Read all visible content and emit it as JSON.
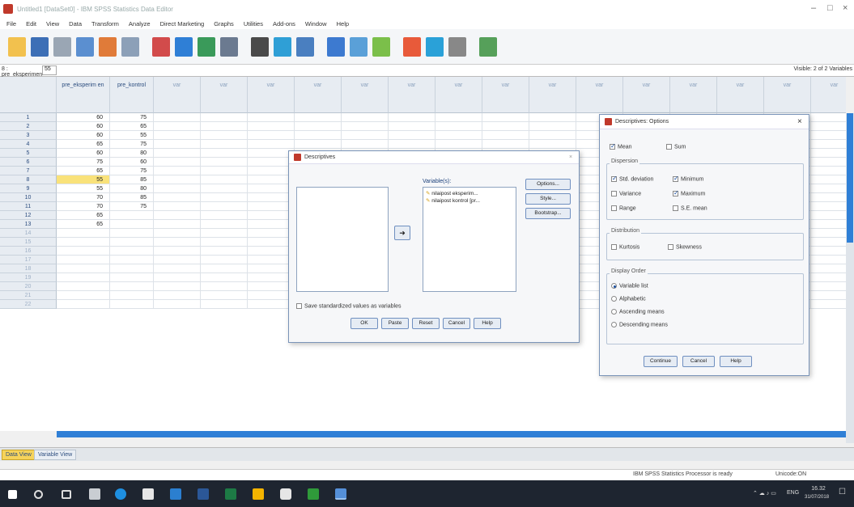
{
  "window": {
    "title": "Untitled1 [DataSet0] - IBM SPSS Statistics Data Editor"
  },
  "menu": [
    "File",
    "Edit",
    "View",
    "Data",
    "Transform",
    "Analyze",
    "Direct Marketing",
    "Graphs",
    "Utilities",
    "Add-ons",
    "Window",
    "Help"
  ],
  "cellbar": {
    "name": "8 : pre_eksperimen",
    "value": "55",
    "visible": "Visible: 2 of 2 Variables"
  },
  "grid": {
    "columns": [
      {
        "label": "pre_eksperim en"
      },
      {
        "label": "pre_kontrol"
      },
      {
        "label": "var"
      },
      {
        "label": "var"
      },
      {
        "label": "var"
      },
      {
        "label": "var"
      },
      {
        "label": "var"
      },
      {
        "label": "var"
      },
      {
        "label": "var"
      },
      {
        "label": "var"
      },
      {
        "label": "var"
      },
      {
        "label": "var"
      },
      {
        "label": "var"
      },
      {
        "label": "var"
      },
      {
        "label": "var"
      },
      {
        "label": "var"
      },
      {
        "label": "var"
      }
    ],
    "rows": [
      {
        "n": "1",
        "a": "60",
        "b": "75"
      },
      {
        "n": "2",
        "a": "60",
        "b": "65"
      },
      {
        "n": "3",
        "a": "60",
        "b": "55"
      },
      {
        "n": "4",
        "a": "65",
        "b": "75"
      },
      {
        "n": "5",
        "a": "60",
        "b": "80"
      },
      {
        "n": "6",
        "a": "75",
        "b": "60"
      },
      {
        "n": "7",
        "a": "65",
        "b": "75"
      },
      {
        "n": "8",
        "a": "55",
        "b": "85"
      },
      {
        "n": "9",
        "a": "55",
        "b": "80"
      },
      {
        "n": "10",
        "a": "70",
        "b": "85"
      },
      {
        "n": "11",
        "a": "70",
        "b": "75"
      },
      {
        "n": "12",
        "a": "65",
        "b": ""
      },
      {
        "n": "13",
        "a": "65",
        "b": ""
      },
      {
        "n": "14",
        "a": "",
        "b": ""
      },
      {
        "n": "15",
        "a": "",
        "b": ""
      },
      {
        "n": "16",
        "a": "",
        "b": ""
      },
      {
        "n": "17",
        "a": "",
        "b": ""
      },
      {
        "n": "18",
        "a": "",
        "b": ""
      },
      {
        "n": "19",
        "a": "",
        "b": ""
      },
      {
        "n": "20",
        "a": "",
        "b": ""
      },
      {
        "n": "21",
        "a": "",
        "b": ""
      },
      {
        "n": "22",
        "a": "",
        "b": ""
      }
    ]
  },
  "descriptives": {
    "title": "Descriptives",
    "variables_label": "Variable(s):",
    "variables": [
      "nilaipost eksperim...",
      "nilaipost kontrol [pr..."
    ],
    "options": "Options...",
    "style": "Style...",
    "bootstrap": "Bootstrap...",
    "arrow": "➜",
    "save_label": "Save standardized values as variables",
    "ok": "OK",
    "paste": "Paste",
    "reset": "Reset",
    "cancel": "Cancel",
    "help": "Help"
  },
  "options": {
    "title": "Descriptives: Options",
    "mean": "Mean",
    "sum": "Sum",
    "dispersion": "Dispersion",
    "std": "Std. deviation",
    "minimum": "Minimum",
    "variance": "Variance",
    "maximum": "Maximum",
    "range": "Range",
    "se": "S.E. mean",
    "distribution": "Distribution",
    "kurtosis": "Kurtosis",
    "skewness": "Skewness",
    "order": "Display Order",
    "o1": "Variable list",
    "o2": "Alphabetic",
    "o3": "Ascending means",
    "o4": "Descending means",
    "continue": "Continue",
    "cancel": "Cancel",
    "help": "Help"
  },
  "tabs": {
    "data": "Data View",
    "variable": "Variable View"
  },
  "status": {
    "processor": "IBM SPSS Statistics Processor is ready",
    "unicode": "Unicode:ON"
  },
  "tray": {
    "lang": "ENG",
    "time": "16.32",
    "date": "31/07/2018"
  },
  "colors": {
    "accent": "#2f7fd6",
    "header": "#e7ecf2",
    "taskbar": "#1e2530",
    "selected": "#f9e27a"
  }
}
